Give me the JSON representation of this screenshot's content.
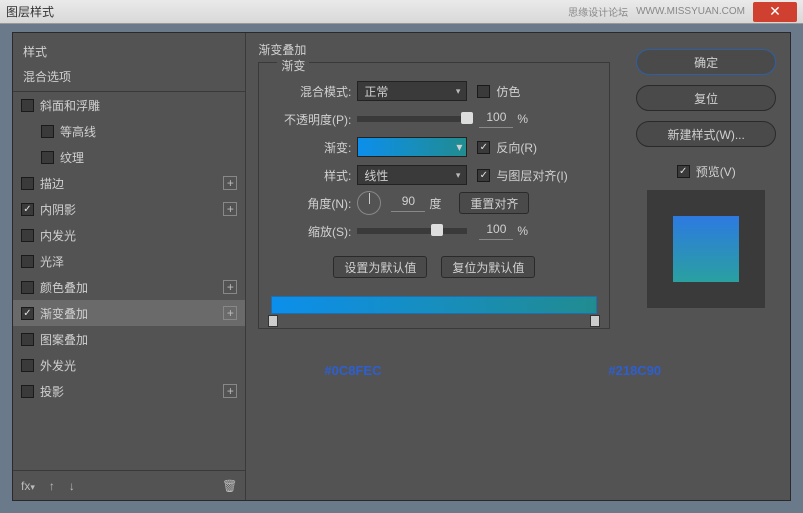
{
  "window": {
    "title": "图层样式",
    "watermark_text": "思缘设计论坛",
    "watermark_url": "WWW.MISSYUAN.COM"
  },
  "left": {
    "heading": "样式",
    "sub": "混合选项",
    "items": [
      {
        "label": "斜面和浮雕",
        "checked": false,
        "plus": false,
        "indent": false
      },
      {
        "label": "等高线",
        "checked": false,
        "plus": false,
        "indent": true
      },
      {
        "label": "纹理",
        "checked": false,
        "plus": false,
        "indent": true
      },
      {
        "label": "描边",
        "checked": false,
        "plus": true,
        "indent": false
      },
      {
        "label": "内阴影",
        "checked": true,
        "plus": true,
        "indent": false
      },
      {
        "label": "内发光",
        "checked": false,
        "plus": false,
        "indent": false
      },
      {
        "label": "光泽",
        "checked": false,
        "plus": false,
        "indent": false
      },
      {
        "label": "颜色叠加",
        "checked": false,
        "plus": true,
        "indent": false
      },
      {
        "label": "渐变叠加",
        "checked": true,
        "plus": true,
        "indent": false,
        "selected": true
      },
      {
        "label": "图案叠加",
        "checked": false,
        "plus": false,
        "indent": false
      },
      {
        "label": "外发光",
        "checked": false,
        "plus": false,
        "indent": false
      },
      {
        "label": "投影",
        "checked": false,
        "plus": true,
        "indent": false
      }
    ],
    "footer_fx": "fx"
  },
  "center": {
    "section_title": "渐变叠加",
    "legend": "渐变",
    "blend_label": "混合模式:",
    "blend_value": "正常",
    "dither": "仿色",
    "opacity_label": "不透明度(P):",
    "opacity_value": "100",
    "pct": "%",
    "grad_label": "渐变:",
    "reverse": "反向(R)",
    "style_label": "样式:",
    "style_value": "线性",
    "align": "与图层对齐(I)",
    "angle_label": "角度(N):",
    "angle_value": "90",
    "deg": "度",
    "reset_align": "重置对齐",
    "scale_label": "缩放(S):",
    "scale_value": "100",
    "set_default": "设置为默认值",
    "reset_default": "复位为默认值",
    "hex_left": "#0C8FEC",
    "hex_right": "#218C90"
  },
  "right": {
    "ok": "确定",
    "reset": "复位",
    "new_style": "新建样式(W)...",
    "preview_label": "预览(V)"
  }
}
